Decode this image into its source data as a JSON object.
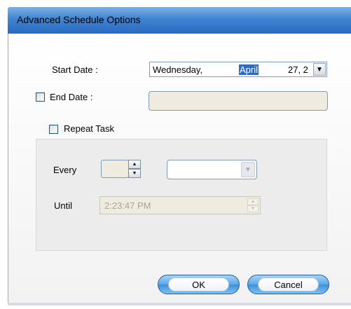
{
  "window": {
    "title": "Advanced Schedule Options"
  },
  "form": {
    "start_date_label": "Start Date :",
    "start_date": {
      "weekday": "Wednesday,",
      "month": "April",
      "rest": "27, 2"
    },
    "end_date_label": "End Date :",
    "end_date_checked": false,
    "end_date_value": "",
    "repeat_task_label": "Repeat Task",
    "repeat_task_checked": false,
    "every_label": "Every",
    "every_value": "",
    "every_unit_value": "",
    "until_label": "Until",
    "until_value": "2:23:47 PM"
  },
  "buttons": {
    "ok": "OK",
    "cancel": "Cancel"
  },
  "icons": {
    "dropdown": "chevron-down-icon",
    "spin_up": "arrow-up-icon",
    "spin_down": "arrow-down-icon"
  },
  "colors": {
    "titlebar": "#3f84d3",
    "selection": "#316ac5",
    "disabled_field": "#efebde"
  }
}
